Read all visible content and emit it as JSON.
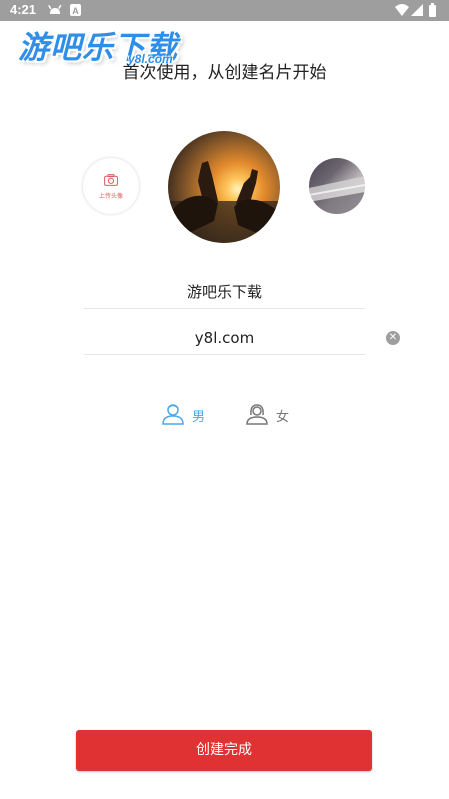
{
  "status_bar": {
    "time": "4:21",
    "icons": [
      "android-debug-icon",
      "notification-a-icon",
      "wifi-icon",
      "signal-icon",
      "battery-icon"
    ]
  },
  "watermark": {
    "text": "游吧乐下载",
    "subtext": "y8l.com"
  },
  "header": {
    "title": "首次使用，从创建名片开始"
  },
  "avatar_picker": {
    "upload_label": "上传头像",
    "selected_avatar": "beer-bottles-sunset-photo",
    "next_avatar": "laptop-keyboard-photo"
  },
  "form": {
    "name_value": "游吧乐下载",
    "second_value": "y8l.com"
  },
  "gender": {
    "male_label": "男",
    "female_label": "女",
    "selected": "male",
    "colors": {
      "selected": "#4aa9ea",
      "unselected": "#777777"
    }
  },
  "footer": {
    "submit_label": "创建完成"
  },
  "colors": {
    "accent": "#e03232",
    "status_bar": "#9e9e9e",
    "watermark": "#2f8ee8"
  }
}
